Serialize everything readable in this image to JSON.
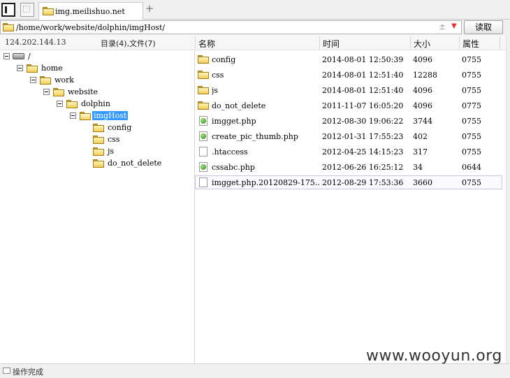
{
  "tab": {
    "title": "img.meilishuo.net"
  },
  "address": {
    "path": "/home/work/website/dolphin/imgHost/",
    "read_button": "读取"
  },
  "info": {
    "ip": "124.202.144.13",
    "counts": "目录(4),文件(7)"
  },
  "columns": {
    "name": "名称",
    "time": "时间",
    "size": "大小",
    "perm": "属性"
  },
  "tree": [
    {
      "label": "/",
      "icon": "drive-icon"
    },
    {
      "label": "home",
      "icon": "folder-icon"
    },
    {
      "label": "work",
      "icon": "folder-icon"
    },
    {
      "label": "website",
      "icon": "folder-icon"
    },
    {
      "label": "dolphin",
      "icon": "folder-icon"
    },
    {
      "label": "imgHost",
      "icon": "folder-open-icon",
      "selected": true
    },
    {
      "label": "config",
      "icon": "folder-icon"
    },
    {
      "label": "css",
      "icon": "folder-icon"
    },
    {
      "label": "js",
      "icon": "folder-icon"
    },
    {
      "label": "do_not_delete",
      "icon": "folder-icon"
    }
  ],
  "files": [
    {
      "name": "config",
      "time": "2014-08-01 12:50:39",
      "size": "4096",
      "perm": "0755",
      "type": "folder"
    },
    {
      "name": "css",
      "time": "2014-08-01 12:51:40",
      "size": "12288",
      "perm": "0755",
      "type": "folder"
    },
    {
      "name": "js",
      "time": "2014-08-01 12:51:40",
      "size": "4096",
      "perm": "0755",
      "type": "folder"
    },
    {
      "name": "do_not_delete",
      "time": "2011-11-07 16:05:20",
      "size": "4096",
      "perm": "0775",
      "type": "folder"
    },
    {
      "name": "imgget.php",
      "time": "2012-08-30 19:06:22",
      "size": "3744",
      "perm": "0755",
      "type": "php"
    },
    {
      "name": "create_pic_thumb.php",
      "time": "2012-01-31 17:55:23",
      "size": "402",
      "perm": "0755",
      "type": "php"
    },
    {
      "name": ".htaccess",
      "time": "2012-04-25 14:15:23",
      "size": "317",
      "perm": "0755",
      "type": "file"
    },
    {
      "name": "cssabc.php",
      "time": "2012-06-26 16:25:12",
      "size": "34",
      "perm": "0644",
      "type": "php"
    },
    {
      "name": "imgget.php.20120829-175...",
      "time": "2012-08-29 17:53:36",
      "size": "3660",
      "perm": "0755",
      "type": "file",
      "selected": true
    }
  ],
  "status": {
    "text": "操作完成"
  },
  "watermark": {
    "text": "www.wooyun.org"
  }
}
